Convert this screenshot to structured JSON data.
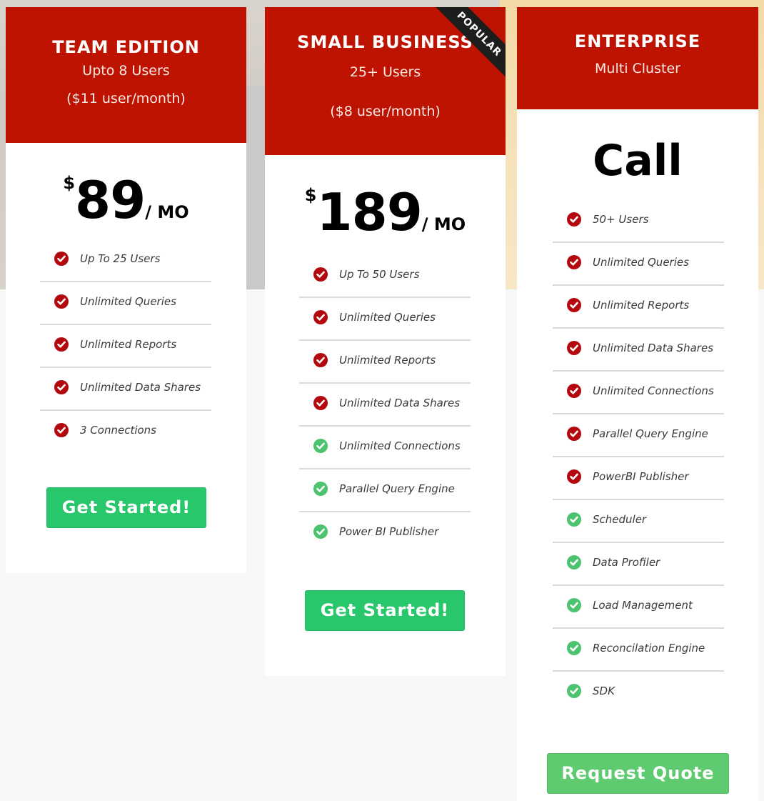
{
  "plans": [
    {
      "name": "TEAM EDITION",
      "sub1": "Upto 8 Users",
      "sub2": "($11 user/month)",
      "currency": "$",
      "amount": "89",
      "period": "/ MO",
      "features": [
        {
          "label": "Up To 25 Users",
          "icon": "check-red"
        },
        {
          "label": "Unlimited Queries",
          "icon": "check-red"
        },
        {
          "label": "Unlimited Reports",
          "icon": "check-red"
        },
        {
          "label": "Unlimited Data Shares",
          "icon": "check-red"
        },
        {
          "label": "3 Connections",
          "icon": "check-red"
        }
      ],
      "button": "Get Started!"
    },
    {
      "name": "SMALL BUSINESS",
      "sub1": "25+ Users",
      "sub2": "($8 user/month)",
      "ribbon": "POPULAR",
      "currency": "$",
      "amount": "189",
      "period": "/ MO",
      "features": [
        {
          "label": "Up To 50 Users",
          "icon": "check-red"
        },
        {
          "label": "Unlimited Queries",
          "icon": "check-red"
        },
        {
          "label": "Unlimited Reports",
          "icon": "check-red"
        },
        {
          "label": "Unlimited Data Shares",
          "icon": "check-red"
        },
        {
          "label": "Unlimited Connections",
          "icon": "check-green"
        },
        {
          "label": "Parallel Query Engine",
          "icon": "check-green"
        },
        {
          "label": "Power BI Publisher",
          "icon": "check-green"
        }
      ],
      "button": "Get Started!"
    },
    {
      "name": "ENTERPRISE",
      "sub1": "Multi Cluster",
      "price_text": "Call",
      "features": [
        {
          "label": "50+ Users",
          "icon": "check-red"
        },
        {
          "label": "Unlimited Queries",
          "icon": "check-red"
        },
        {
          "label": "Unlimited Reports",
          "icon": "check-red"
        },
        {
          "label": "Unlimited Data Shares",
          "icon": "check-red"
        },
        {
          "label": "Unlimited Connections",
          "icon": "check-red"
        },
        {
          "label": "Parallel Query Engine",
          "icon": "check-red"
        },
        {
          "label": "PowerBI Publisher",
          "icon": "check-red"
        },
        {
          "label": "Scheduler",
          "icon": "check-green"
        },
        {
          "label": "Data Profiler",
          "icon": "check-green"
        },
        {
          "label": "Load Management",
          "icon": "check-green"
        },
        {
          "label": "Reconcilation Engine",
          "icon": "check-green"
        },
        {
          "label": "SDK",
          "icon": "check-green"
        }
      ],
      "button": "Request Quote"
    }
  ],
  "colors": {
    "header_red": "#bd1300",
    "check_red": "#b3080e",
    "check_green": "#4cc36e",
    "button_green": "#28c76b",
    "button_light_green": "#5ecb70"
  }
}
